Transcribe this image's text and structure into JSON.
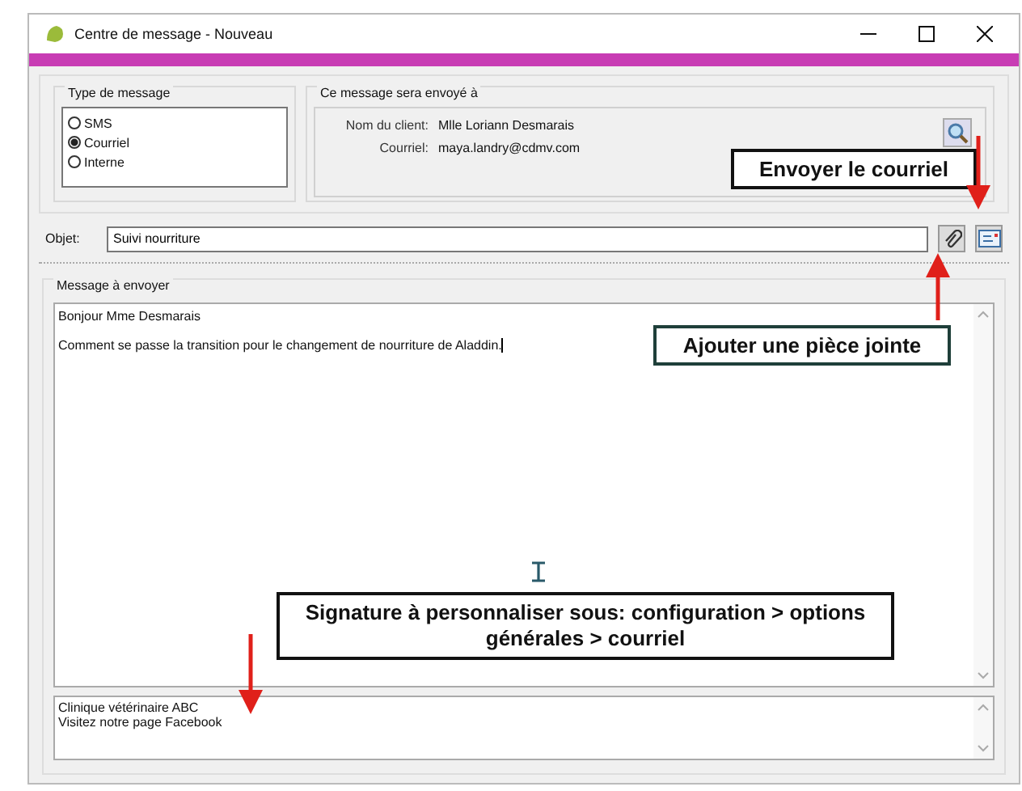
{
  "window": {
    "title": "Centre de message - Nouveau"
  },
  "message_type": {
    "label": "Type de message",
    "options": [
      {
        "label": "SMS",
        "selected": false
      },
      {
        "label": "Courriel",
        "selected": true
      },
      {
        "label": "Interne",
        "selected": false
      }
    ]
  },
  "recipient": {
    "label": "Ce message sera envoyé à",
    "client_label": "Nom du client:",
    "client": "Mlle Loriann Desmarais",
    "email_label": "Courriel:",
    "email": "maya.landry@cdmv.com"
  },
  "subject": {
    "label": "Objet:",
    "value": "Suivi nourriture"
  },
  "message": {
    "label": "Message à envoyer",
    "paragraphs": [
      "Bonjour Mme Desmarais",
      "Comment se passe la transition pour le changement de nourriture de Aladdin."
    ]
  },
  "signature": {
    "lines": [
      "Clinique vétérinaire ABC",
      "Visitez notre page Facebook"
    ]
  },
  "annotations": [
    {
      "kind": "send",
      "text": "Envoyer le courriel"
    },
    {
      "kind": "attach",
      "text": "Ajouter une pièce jointe"
    },
    {
      "kind": "signature",
      "text": "Signature à personnaliser sous: configuration > options générales > courriel"
    }
  ]
}
